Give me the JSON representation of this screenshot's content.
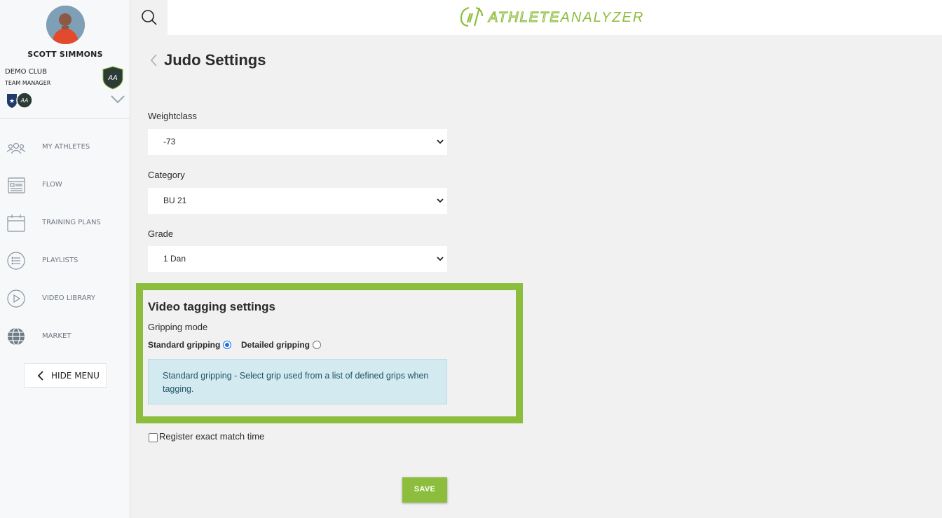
{
  "sidebar": {
    "user_name": "SCOTT SIMMONS",
    "club_name": "DEMO CLUB",
    "club_role": "TEAM MANAGER",
    "items": [
      {
        "label": "MY ATHLETES",
        "icon": "users-icon"
      },
      {
        "label": "FLOW",
        "icon": "flow-icon"
      },
      {
        "label": "TRAINING PLANS",
        "icon": "calendar-icon"
      },
      {
        "label": "PLAYLISTS",
        "icon": "list-icon"
      },
      {
        "label": "VIDEO LIBRARY",
        "icon": "play-icon"
      },
      {
        "label": "MARKET",
        "icon": "globe-icon"
      }
    ],
    "hide_menu_label": "HIDE MENU"
  },
  "header": {
    "logo_text_part1": "ATHLETE",
    "logo_text_part2": "ANALYZER",
    "brand_color": "#8dbd3c"
  },
  "page": {
    "title": "Judo Settings",
    "weightclass_label": "Weightclass",
    "weightclass_value": "-73",
    "category_label": "Category",
    "category_value": "BU 21",
    "grade_label": "Grade",
    "grade_value": "1 Dan",
    "video_section_title": "Video tagging settings",
    "gripping_mode_label": "Gripping mode",
    "standard_gripping_label": "Standard gripping",
    "detailed_gripping_label": "Detailed gripping",
    "selected_gripping": "Standard gripping",
    "info_text": "Standard gripping - Select grip used from a list of defined grips when tagging.",
    "exact_match_label": "Register exact match time",
    "save_label": "SAVE"
  }
}
